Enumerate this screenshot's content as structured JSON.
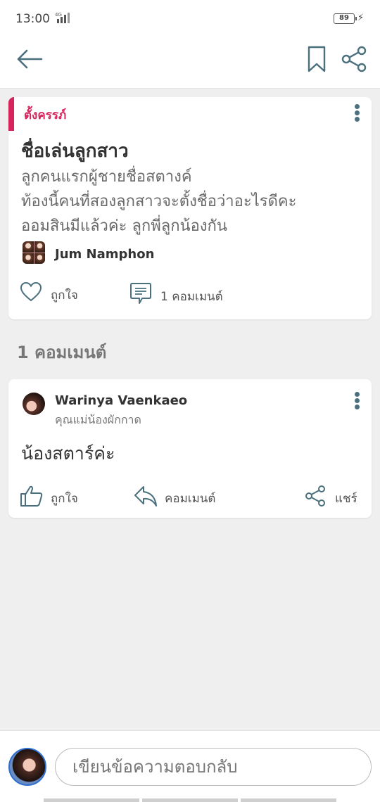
{
  "status": {
    "time": "13:00",
    "network": "4G",
    "battery": "89"
  },
  "appbar": {
    "back_icon": "arrow-left-icon",
    "bookmark_icon": "bookmark-icon",
    "share_icon": "share-icon"
  },
  "post": {
    "tag": "ตั้งครรภ์",
    "title": "ชื่อเล่นลูกสาว",
    "body_lines": [
      "ลูกคนแรกผู้ชายชื่อสตางค์",
      "ท้องนี้คนที่สองลูกสาวจะตั้งชื่อว่าอะไรดีคะ",
      "ออมสินมีแล้วค่ะ ลูกพี่ลูกน้องกัน"
    ],
    "author": "Jum Namphon",
    "like_label": "ถูกใจ",
    "comment_label": "1 คอมเมนต์"
  },
  "comments_section": {
    "title": "1 คอมเมนต์"
  },
  "comment": {
    "name": "Warinya Vaenkaeo",
    "subtitle": "คุณแม่น้องผักกาด",
    "text": "น้องสตาร์ค่ะ",
    "like_label": "ถูกใจ",
    "reply_label": "คอมเมนต์",
    "share_label": "แชร์"
  },
  "composer": {
    "placeholder": "เขียนข้อความตอบกลับ"
  },
  "colors": {
    "accent": "#d6245c",
    "icon": "#4a6f7d",
    "background": "#efefef"
  }
}
